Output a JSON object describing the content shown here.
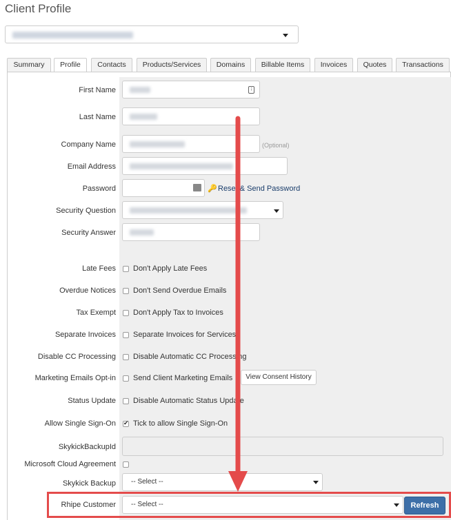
{
  "page": {
    "title": "Client Profile"
  },
  "client_selector": {
    "value_obscured": true
  },
  "tabs": [
    {
      "label": "Summary",
      "active": false
    },
    {
      "label": "Profile",
      "active": true
    },
    {
      "label": "Contacts",
      "active": false
    },
    {
      "label": "Products/Services",
      "active": false
    },
    {
      "label": "Domains",
      "active": false
    },
    {
      "label": "Billable Items",
      "active": false
    },
    {
      "label": "Invoices",
      "active": false
    },
    {
      "label": "Quotes",
      "active": false
    },
    {
      "label": "Transactions",
      "active": false
    }
  ],
  "form": {
    "first_name": {
      "label": "First Name"
    },
    "last_name": {
      "label": "Last Name"
    },
    "company_name": {
      "label": "Company Name",
      "hint": "(Optional)"
    },
    "email": {
      "label": "Email Address"
    },
    "password": {
      "label": "Password",
      "reset_link": "Reset & Send Password"
    },
    "security_question": {
      "label": "Security Question"
    },
    "security_answer": {
      "label": "Security Answer"
    },
    "late_fees": {
      "label": "Late Fees",
      "checkbox_label": "Don't Apply Late Fees",
      "checked": false
    },
    "overdue_notices": {
      "label": "Overdue Notices",
      "checkbox_label": "Don't Send Overdue Emails",
      "checked": false
    },
    "tax_exempt": {
      "label": "Tax Exempt",
      "checkbox_label": "Don't Apply Tax to Invoices",
      "checked": false
    },
    "separate_invoices": {
      "label": "Separate Invoices",
      "checkbox_label": "Separate Invoices for Services",
      "checked": false
    },
    "disable_cc": {
      "label": "Disable CC Processing",
      "checkbox_label": "Disable Automatic CC Processing",
      "checked": false
    },
    "marketing": {
      "label": "Marketing Emails Opt-in",
      "checkbox_label": "Send Client Marketing Emails",
      "checked": false,
      "button": "View Consent History"
    },
    "status_update": {
      "label": "Status Update",
      "checkbox_label": "Disable Automatic Status Update",
      "checked": false
    },
    "sso": {
      "label": "Allow Single Sign-On",
      "checkbox_label": "Tick to allow Single Sign-On",
      "checked": true
    },
    "skykick_backup_id": {
      "label": "SkykickBackupId"
    },
    "ms_cloud": {
      "label": "Microsoft Cloud Agreement",
      "checked": false
    },
    "skykick_backup": {
      "label": "Skykick Backup",
      "value": "-- Select --"
    },
    "rhipe_customer": {
      "label": "Rhipe Customer",
      "value": "-- Select --",
      "button": "Refresh"
    }
  },
  "annotation": {
    "color": "#e44b4b"
  }
}
